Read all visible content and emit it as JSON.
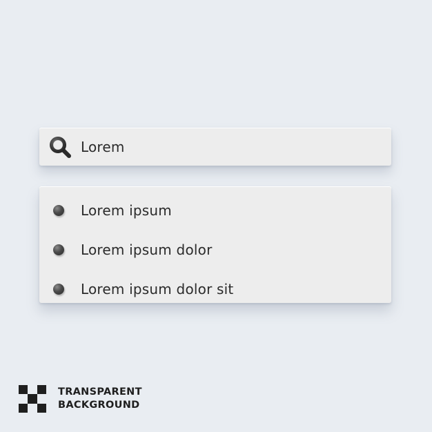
{
  "search": {
    "icon": "search-icon",
    "value": "Lorem"
  },
  "suggestions": {
    "items": [
      {
        "label": "Lorem ipsum",
        "icon": "bullet-icon"
      },
      {
        "label": "Lorem ipsum dolor",
        "icon": "bullet-icon"
      },
      {
        "label": "Lorem ipsum dolor sit",
        "icon": "bullet-icon"
      }
    ]
  },
  "badge": {
    "icon": "checkerboard-icon",
    "line1": "TRANSPARENT",
    "line2": "BACKGROUND"
  },
  "colors": {
    "background": "#e9edf2",
    "panel": "#ededed",
    "text": "#2b2b2b",
    "icon": "#3a3a3a"
  }
}
